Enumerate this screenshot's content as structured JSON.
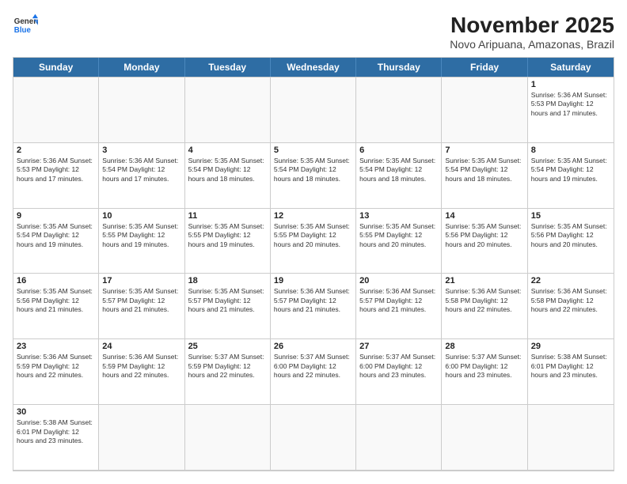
{
  "logo": {
    "line1": "General",
    "line2": "Blue"
  },
  "title": "November 2025",
  "subtitle": "Novo Aripuana, Amazonas, Brazil",
  "days_of_week": [
    "Sunday",
    "Monday",
    "Tuesday",
    "Wednesday",
    "Thursday",
    "Friday",
    "Saturday"
  ],
  "weeks": [
    [
      {
        "day": "",
        "info": "",
        "empty": true
      },
      {
        "day": "",
        "info": "",
        "empty": true
      },
      {
        "day": "",
        "info": "",
        "empty": true
      },
      {
        "day": "",
        "info": "",
        "empty": true
      },
      {
        "day": "",
        "info": "",
        "empty": true
      },
      {
        "day": "",
        "info": "",
        "empty": true
      },
      {
        "day": "1",
        "info": "Sunrise: 5:36 AM\nSunset: 5:53 PM\nDaylight: 12 hours and 17 minutes.",
        "empty": false
      }
    ],
    [
      {
        "day": "2",
        "info": "Sunrise: 5:36 AM\nSunset: 5:53 PM\nDaylight: 12 hours and 17 minutes.",
        "empty": false
      },
      {
        "day": "3",
        "info": "Sunrise: 5:36 AM\nSunset: 5:54 PM\nDaylight: 12 hours and 17 minutes.",
        "empty": false
      },
      {
        "day": "4",
        "info": "Sunrise: 5:35 AM\nSunset: 5:54 PM\nDaylight: 12 hours and 18 minutes.",
        "empty": false
      },
      {
        "day": "5",
        "info": "Sunrise: 5:35 AM\nSunset: 5:54 PM\nDaylight: 12 hours and 18 minutes.",
        "empty": false
      },
      {
        "day": "6",
        "info": "Sunrise: 5:35 AM\nSunset: 5:54 PM\nDaylight: 12 hours and 18 minutes.",
        "empty": false
      },
      {
        "day": "7",
        "info": "Sunrise: 5:35 AM\nSunset: 5:54 PM\nDaylight: 12 hours and 18 minutes.",
        "empty": false
      },
      {
        "day": "8",
        "info": "Sunrise: 5:35 AM\nSunset: 5:54 PM\nDaylight: 12 hours and 19 minutes.",
        "empty": false
      }
    ],
    [
      {
        "day": "9",
        "info": "Sunrise: 5:35 AM\nSunset: 5:54 PM\nDaylight: 12 hours and 19 minutes.",
        "empty": false
      },
      {
        "day": "10",
        "info": "Sunrise: 5:35 AM\nSunset: 5:55 PM\nDaylight: 12 hours and 19 minutes.",
        "empty": false
      },
      {
        "day": "11",
        "info": "Sunrise: 5:35 AM\nSunset: 5:55 PM\nDaylight: 12 hours and 19 minutes.",
        "empty": false
      },
      {
        "day": "12",
        "info": "Sunrise: 5:35 AM\nSunset: 5:55 PM\nDaylight: 12 hours and 20 minutes.",
        "empty": false
      },
      {
        "day": "13",
        "info": "Sunrise: 5:35 AM\nSunset: 5:55 PM\nDaylight: 12 hours and 20 minutes.",
        "empty": false
      },
      {
        "day": "14",
        "info": "Sunrise: 5:35 AM\nSunset: 5:56 PM\nDaylight: 12 hours and 20 minutes.",
        "empty": false
      },
      {
        "day": "15",
        "info": "Sunrise: 5:35 AM\nSunset: 5:56 PM\nDaylight: 12 hours and 20 minutes.",
        "empty": false
      }
    ],
    [
      {
        "day": "16",
        "info": "Sunrise: 5:35 AM\nSunset: 5:56 PM\nDaylight: 12 hours and 21 minutes.",
        "empty": false
      },
      {
        "day": "17",
        "info": "Sunrise: 5:35 AM\nSunset: 5:57 PM\nDaylight: 12 hours and 21 minutes.",
        "empty": false
      },
      {
        "day": "18",
        "info": "Sunrise: 5:35 AM\nSunset: 5:57 PM\nDaylight: 12 hours and 21 minutes.",
        "empty": false
      },
      {
        "day": "19",
        "info": "Sunrise: 5:36 AM\nSunset: 5:57 PM\nDaylight: 12 hours and 21 minutes.",
        "empty": false
      },
      {
        "day": "20",
        "info": "Sunrise: 5:36 AM\nSunset: 5:57 PM\nDaylight: 12 hours and 21 minutes.",
        "empty": false
      },
      {
        "day": "21",
        "info": "Sunrise: 5:36 AM\nSunset: 5:58 PM\nDaylight: 12 hours and 22 minutes.",
        "empty": false
      },
      {
        "day": "22",
        "info": "Sunrise: 5:36 AM\nSunset: 5:58 PM\nDaylight: 12 hours and 22 minutes.",
        "empty": false
      }
    ],
    [
      {
        "day": "23",
        "info": "Sunrise: 5:36 AM\nSunset: 5:59 PM\nDaylight: 12 hours and 22 minutes.",
        "empty": false
      },
      {
        "day": "24",
        "info": "Sunrise: 5:36 AM\nSunset: 5:59 PM\nDaylight: 12 hours and 22 minutes.",
        "empty": false
      },
      {
        "day": "25",
        "info": "Sunrise: 5:37 AM\nSunset: 5:59 PM\nDaylight: 12 hours and 22 minutes.",
        "empty": false
      },
      {
        "day": "26",
        "info": "Sunrise: 5:37 AM\nSunset: 6:00 PM\nDaylight: 12 hours and 22 minutes.",
        "empty": false
      },
      {
        "day": "27",
        "info": "Sunrise: 5:37 AM\nSunset: 6:00 PM\nDaylight: 12 hours and 23 minutes.",
        "empty": false
      },
      {
        "day": "28",
        "info": "Sunrise: 5:37 AM\nSunset: 6:00 PM\nDaylight: 12 hours and 23 minutes.",
        "empty": false
      },
      {
        "day": "29",
        "info": "Sunrise: 5:38 AM\nSunset: 6:01 PM\nDaylight: 12 hours and 23 minutes.",
        "empty": false
      }
    ],
    [
      {
        "day": "30",
        "info": "Sunrise: 5:38 AM\nSunset: 6:01 PM\nDaylight: 12 hours and 23 minutes.",
        "empty": false
      },
      {
        "day": "",
        "info": "",
        "empty": true
      },
      {
        "day": "",
        "info": "",
        "empty": true
      },
      {
        "day": "",
        "info": "",
        "empty": true
      },
      {
        "day": "",
        "info": "",
        "empty": true
      },
      {
        "day": "",
        "info": "",
        "empty": true
      },
      {
        "day": "",
        "info": "",
        "empty": true
      }
    ]
  ]
}
